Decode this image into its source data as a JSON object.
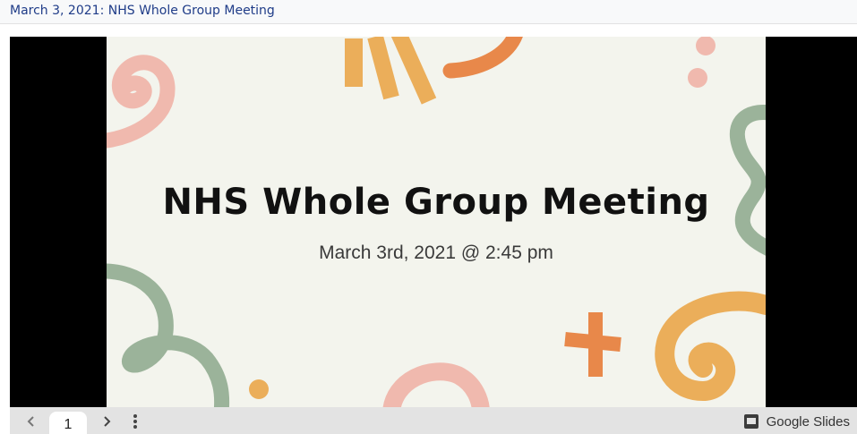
{
  "header": {
    "title": "March 3, 2021: NHS Whole Group Meeting"
  },
  "slide": {
    "title": "NHS Whole Group Meeting",
    "subtitle": "March 3rd, 2021 @ 2:45 pm"
  },
  "toolbar": {
    "prev_icon": "chevron-left-icon",
    "next_icon": "chevron-right-icon",
    "more_icon": "more-vert-icon",
    "page_number": "1",
    "brand_icon": "slides-icon",
    "brand_label": "Google Slides"
  },
  "colors": {
    "slide_bg": "#f3f4ed",
    "pink": "#f0b9ae",
    "orange": "#e8884a",
    "yellow": "#ebae5a",
    "green": "#9bb39a",
    "header_text": "#1f3c88",
    "toolbar_bg": "#e3e3e3"
  }
}
